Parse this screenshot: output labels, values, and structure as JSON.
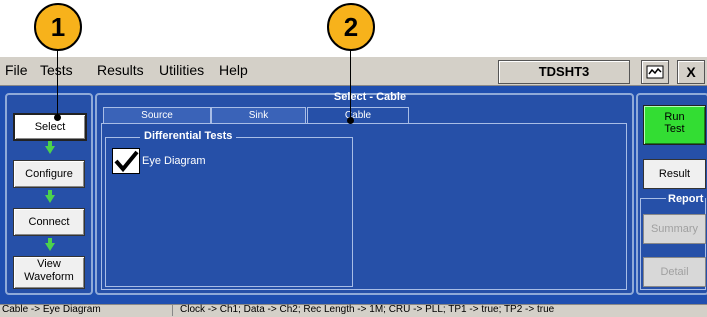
{
  "menu": {
    "items": [
      "File",
      "Tests",
      "Results",
      "Utilities",
      "Help"
    ]
  },
  "app": {
    "title": "TDSHT3",
    "min_icon": "minimize-icon",
    "close_label": "X"
  },
  "steps": [
    {
      "label": "Select",
      "active": true
    },
    {
      "label": "Configure"
    },
    {
      "label": "Connect"
    },
    {
      "label_line1": "View",
      "label_line2": "Waveform"
    }
  ],
  "panel": {
    "title": "Select - Cable"
  },
  "tabs": [
    {
      "label": "Source"
    },
    {
      "label": "Sink"
    },
    {
      "label": "Cable",
      "active": true
    }
  ],
  "tests": {
    "group_label": "Differential Tests",
    "eye_label": "Eye Diagram",
    "eye_checked": true
  },
  "right": {
    "run_line1": "Run",
    "run_line2": "Test",
    "result": "Result",
    "report_label": "Report",
    "summary": "Summary",
    "detail": "Detail"
  },
  "status": {
    "left": "Cable -> Eye Diagram",
    "right": "Clock -> Ch1; Data -> Ch2; Rec Length -> 1M; CRU -> PLL; TP1 -> true; TP2 -> true"
  },
  "callouts": [
    "1",
    "2"
  ],
  "colors": {
    "accent": "#2650a8",
    "run": "#33dd33",
    "callout": "#f7b21b",
    "arrow": "#4cd24c"
  }
}
